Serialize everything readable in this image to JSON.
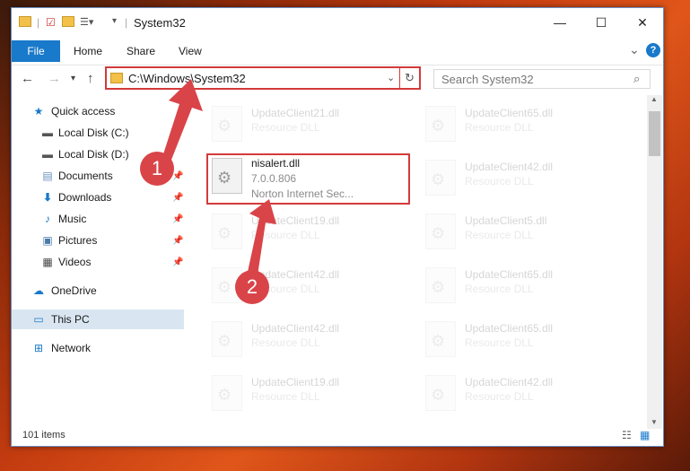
{
  "window": {
    "title": "System32",
    "minimize": "—",
    "maximize": "☐",
    "close": "✕"
  },
  "ribbon": {
    "tabs": [
      "File",
      "Home",
      "Share",
      "View"
    ],
    "expand": "⌄",
    "help": "?"
  },
  "address": {
    "path": "C:\\Windows\\System32",
    "search_placeholder": "Search System32"
  },
  "sidebar": {
    "items": [
      {
        "label": "Quick access",
        "icon": "star-icon"
      },
      {
        "label": "Local Disk (C:)",
        "icon": "drive-icon"
      },
      {
        "label": "Local Disk (D:)",
        "icon": "drive-icon"
      },
      {
        "label": "Documents",
        "icon": "document-icon"
      },
      {
        "label": "Downloads",
        "icon": "download-icon"
      },
      {
        "label": "Music",
        "icon": "music-icon"
      },
      {
        "label": "Pictures",
        "icon": "picture-icon"
      },
      {
        "label": "Videos",
        "icon": "video-icon"
      },
      {
        "label": "OneDrive",
        "icon": "cloud-icon"
      },
      {
        "label": "This PC",
        "icon": "computer-icon"
      },
      {
        "label": "Network",
        "icon": "network-icon"
      }
    ]
  },
  "files": {
    "left": [
      {
        "name": "UpdateClient21.dll",
        "type": "Resource DLL"
      },
      {
        "name": "nisalert.dll",
        "version": "7.0.0.806",
        "company": "Norton Internet Sec..."
      },
      {
        "name": "UpdateClient19.dll",
        "type": "Resource DLL"
      },
      {
        "name": "UpdateClient42.dll",
        "type": "Resource DLL"
      },
      {
        "name": "UpdateClient42.dll",
        "type": "Resource DLL"
      },
      {
        "name": "UpdateClient19.dll",
        "type": "Resource DLL"
      }
    ],
    "right": [
      {
        "name": "UpdateClient65.dll",
        "type": "Resource DLL"
      },
      {
        "name": "UpdateClient42.dll",
        "type": "Resource DLL"
      },
      {
        "name": "UpdateClient5.dll",
        "type": "Resource DLL"
      },
      {
        "name": "UpdateClient65.dll",
        "type": "Resource DLL"
      },
      {
        "name": "UpdateClient65.dll",
        "type": "Resource DLL"
      },
      {
        "name": "UpdateClient42.dll",
        "type": "Resource DLL"
      }
    ]
  },
  "status": {
    "item_count": "101 items"
  },
  "markers": [
    "1",
    "2"
  ],
  "colors": {
    "accent": "#1979ca",
    "highlight": "#d33a3a",
    "marker": "#d94448"
  }
}
